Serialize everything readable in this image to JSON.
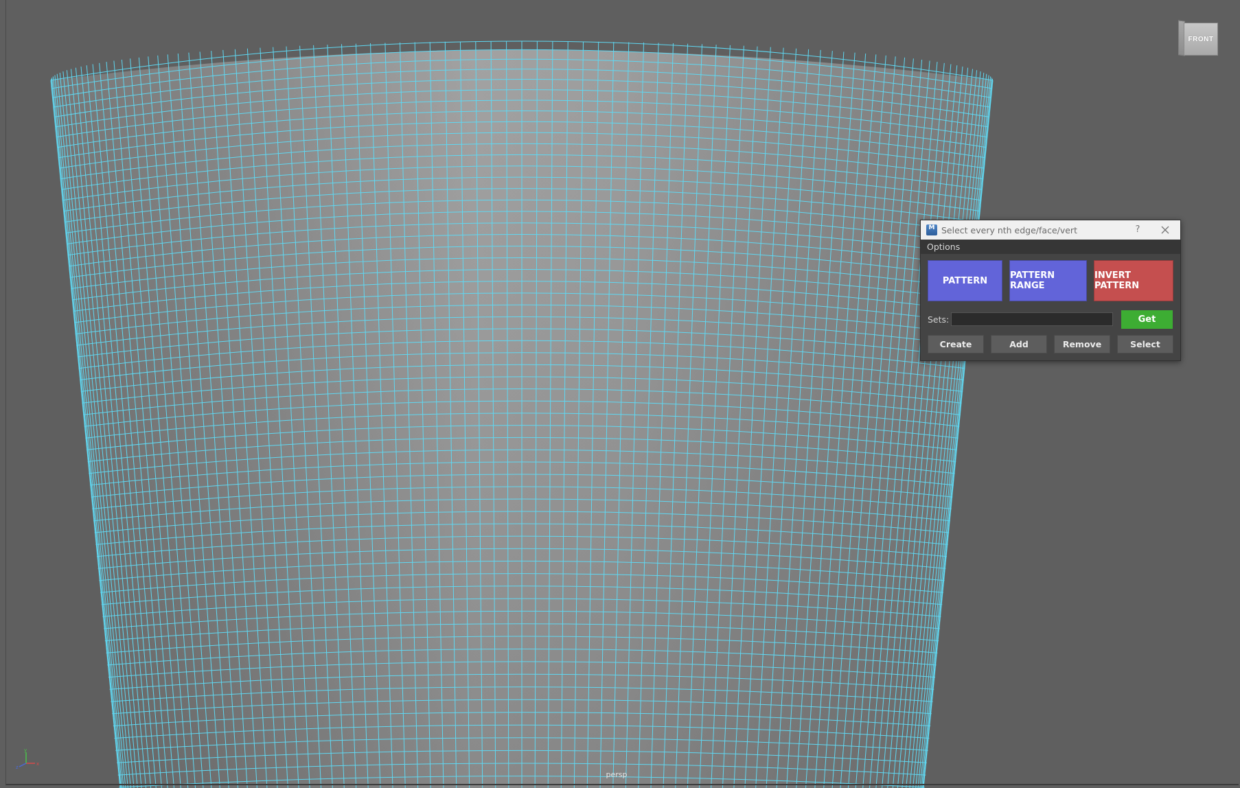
{
  "viewport": {
    "camera_label": "persp",
    "view_cube_face": "FRONT",
    "background_color": "#5f5f5f",
    "wireframe_color": "#5fd8f2",
    "axis_gizmo_icon": "axis-gizmo-icon"
  },
  "tool_window": {
    "title": "Select every nth edge/face/vert",
    "app_icon_letter": "M",
    "help_label": "?",
    "menu": {
      "options_label": "Options"
    },
    "buttons": {
      "pattern_label": "PATTERN",
      "pattern_range_label": "PATTERN RANGE",
      "invert_pattern_label": "INVERT PATTERN",
      "pattern_color": "#6264d9",
      "invert_color": "#c54f4f"
    },
    "sets": {
      "label": "Sets:",
      "value": "",
      "get_label": "Get",
      "get_color": "#3dad33"
    },
    "set_actions": {
      "create_label": "Create",
      "add_label": "Add",
      "remove_label": "Remove",
      "select_label": "Select"
    }
  }
}
